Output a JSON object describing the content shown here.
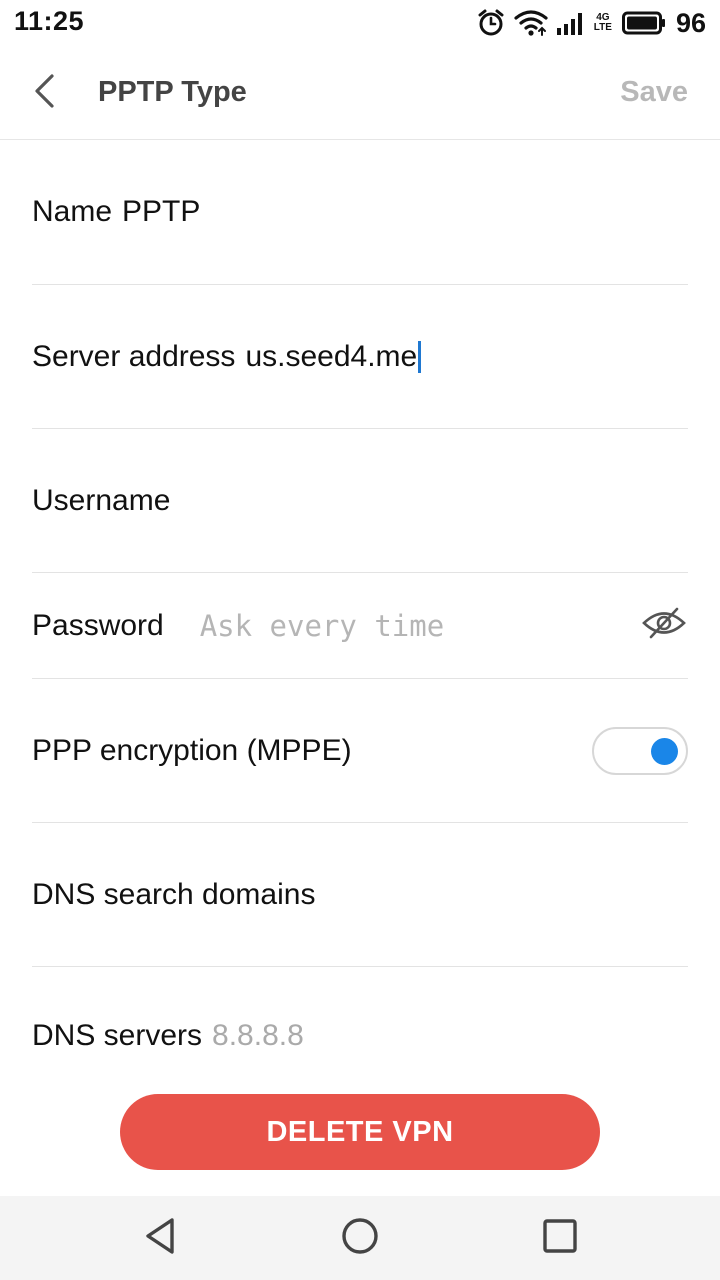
{
  "status_bar": {
    "time": "11:25",
    "network_type_top": "4G",
    "network_type_bottom": "LTE",
    "battery_level": "96",
    "icons": [
      "alarm-icon",
      "wifi-icon",
      "signal-icon",
      "battery-icon"
    ]
  },
  "header": {
    "title": "PPTP Type",
    "save_label": "Save",
    "back_icon": "chevron-left-icon"
  },
  "form": {
    "name": {
      "label": "Name",
      "value": "PPTP"
    },
    "server": {
      "label": "Server address",
      "value": "us.seed4.me"
    },
    "username": {
      "label": "Username",
      "value": ""
    },
    "password": {
      "label": "Password",
      "placeholder": "Ask every time",
      "icon": "eye-hidden-icon"
    },
    "encryption": {
      "label": "PPP encryption (MPPE)",
      "enabled": true
    },
    "dns_domains": {
      "label": "DNS search domains",
      "value": ""
    },
    "dns_servers": {
      "label": "DNS servers",
      "value": "8.8.8.8"
    }
  },
  "delete_button": {
    "label": "DELETE VPN"
  },
  "colors": {
    "accent": "#1a86e8",
    "danger": "#e8534a",
    "muted": "#b8b8b8"
  },
  "nav_bar": {
    "icons": [
      "back-triangle-icon",
      "home-circle-icon",
      "recents-square-icon"
    ]
  }
}
